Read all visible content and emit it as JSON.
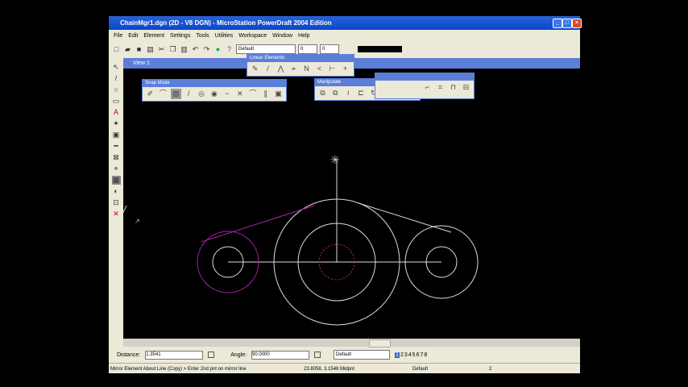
{
  "title": "ChainMgr1.dgn (2D - V8 DGN) - MicroStation PowerDraft 2004 Edition",
  "menu": [
    "File",
    "Edit",
    "Element",
    "Settings",
    "Tools",
    "Utilities",
    "Workspace",
    "Window",
    "Help"
  ],
  "toolbar": {
    "level": "Default",
    "color": "0",
    "weight": "0"
  },
  "view": {
    "title": "View 1"
  },
  "palettes": {
    "linear": "Linear Elements",
    "snap": "Snap Mode",
    "manipulate": "Manipulate"
  },
  "settings": {
    "distance_label": "Distance:",
    "distance": "1.3541",
    "angle_label": "Angle:",
    "angle": "90.0000",
    "view_group": "Default",
    "views": [
      "1",
      "2",
      "3",
      "4",
      "5",
      "6",
      "7",
      "8"
    ]
  },
  "status": {
    "prompt": "Mirror Element About Line (Copy) > Enter 2nd pnt on mirror line",
    "coords": "23.8058, 3.1548 Midpnt",
    "level": "Default",
    "count": "2"
  }
}
